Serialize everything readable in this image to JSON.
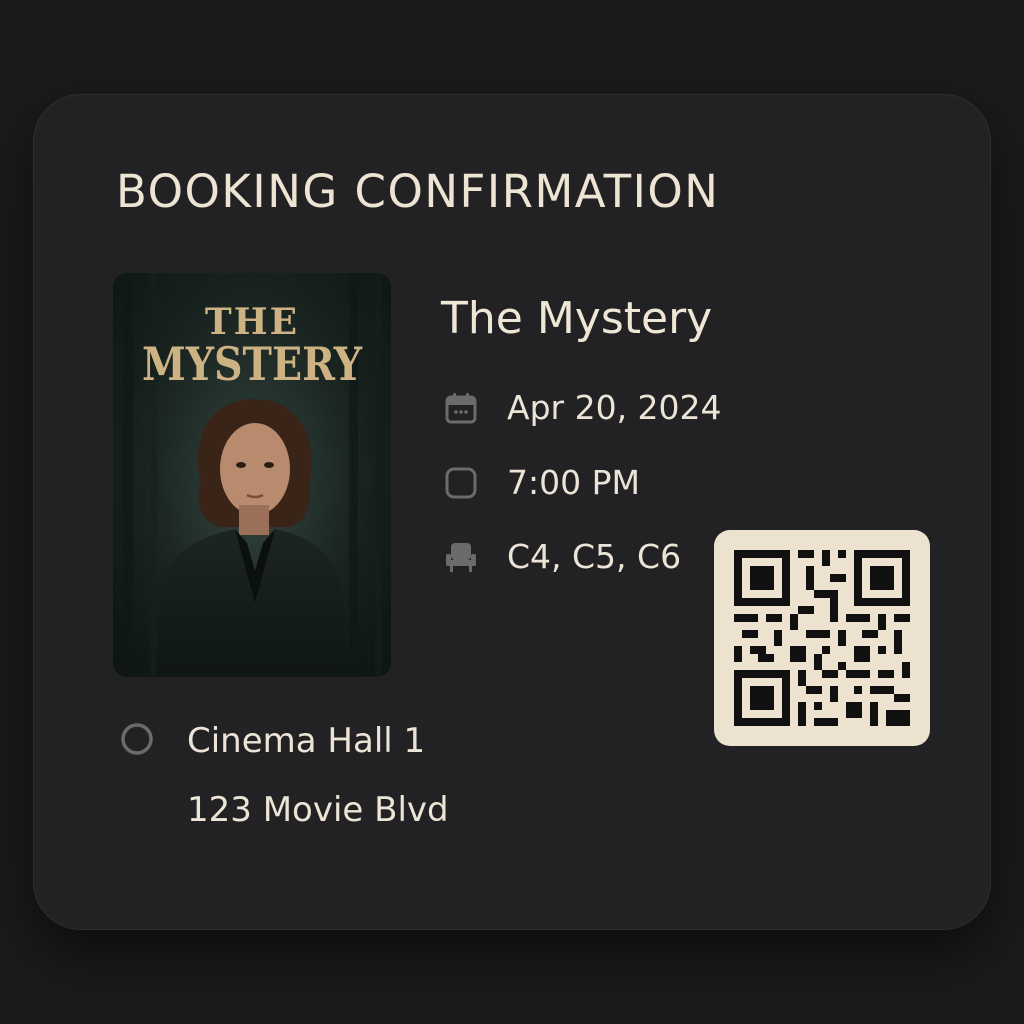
{
  "header": {
    "title": "BOOKING CONFIRMATION"
  },
  "poster": {
    "title_line_1": "THE",
    "title_line_2": "MYSTERY",
    "title_color": "#cdb384",
    "image_subject": "woman in dark coat in misty forest"
  },
  "movie": {
    "title": "The Mystery"
  },
  "details": {
    "date": {
      "icon": "calendar-icon",
      "value": "Apr 20, 2024"
    },
    "time": {
      "icon": "clock-icon",
      "value": "7:00 PM"
    },
    "seats": {
      "icon": "seat-icon",
      "value": "C4, C5, C6"
    }
  },
  "venue": {
    "icon": "location-icon",
    "name": "Cinema Hall 1",
    "address": "123 Movie Blvd"
  },
  "qr_code": {
    "icon": "qr-code-icon",
    "background": "#ede1cf"
  },
  "colors": {
    "page_background": "#1b1b1d",
    "card_background": "#222224",
    "text_primary": "#ece4d6",
    "icon_gray": "#6b6b6e"
  }
}
